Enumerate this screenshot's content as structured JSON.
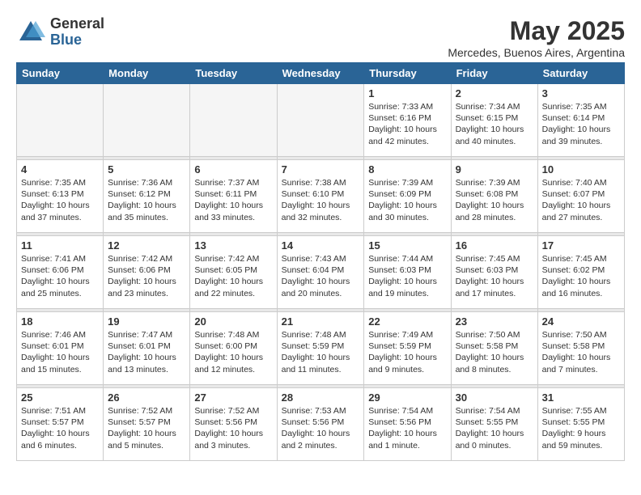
{
  "logo": {
    "general": "General",
    "blue": "Blue"
  },
  "header": {
    "title": "May 2025",
    "subtitle": "Mercedes, Buenos Aires, Argentina"
  },
  "days_of_week": [
    "Sunday",
    "Monday",
    "Tuesday",
    "Wednesday",
    "Thursday",
    "Friday",
    "Saturday"
  ],
  "weeks": [
    [
      {
        "day": "",
        "empty": true
      },
      {
        "day": "",
        "empty": true
      },
      {
        "day": "",
        "empty": true
      },
      {
        "day": "",
        "empty": true
      },
      {
        "day": "1",
        "sunrise": "Sunrise: 7:33 AM",
        "sunset": "Sunset: 6:16 PM",
        "daylight": "Daylight: 10 hours and 42 minutes."
      },
      {
        "day": "2",
        "sunrise": "Sunrise: 7:34 AM",
        "sunset": "Sunset: 6:15 PM",
        "daylight": "Daylight: 10 hours and 40 minutes."
      },
      {
        "day": "3",
        "sunrise": "Sunrise: 7:35 AM",
        "sunset": "Sunset: 6:14 PM",
        "daylight": "Daylight: 10 hours and 39 minutes."
      }
    ],
    [
      {
        "day": "4",
        "sunrise": "Sunrise: 7:35 AM",
        "sunset": "Sunset: 6:13 PM",
        "daylight": "Daylight: 10 hours and 37 minutes."
      },
      {
        "day": "5",
        "sunrise": "Sunrise: 7:36 AM",
        "sunset": "Sunset: 6:12 PM",
        "daylight": "Daylight: 10 hours and 35 minutes."
      },
      {
        "day": "6",
        "sunrise": "Sunrise: 7:37 AM",
        "sunset": "Sunset: 6:11 PM",
        "daylight": "Daylight: 10 hours and 33 minutes."
      },
      {
        "day": "7",
        "sunrise": "Sunrise: 7:38 AM",
        "sunset": "Sunset: 6:10 PM",
        "daylight": "Daylight: 10 hours and 32 minutes."
      },
      {
        "day": "8",
        "sunrise": "Sunrise: 7:39 AM",
        "sunset": "Sunset: 6:09 PM",
        "daylight": "Daylight: 10 hours and 30 minutes."
      },
      {
        "day": "9",
        "sunrise": "Sunrise: 7:39 AM",
        "sunset": "Sunset: 6:08 PM",
        "daylight": "Daylight: 10 hours and 28 minutes."
      },
      {
        "day": "10",
        "sunrise": "Sunrise: 7:40 AM",
        "sunset": "Sunset: 6:07 PM",
        "daylight": "Daylight: 10 hours and 27 minutes."
      }
    ],
    [
      {
        "day": "11",
        "sunrise": "Sunrise: 7:41 AM",
        "sunset": "Sunset: 6:06 PM",
        "daylight": "Daylight: 10 hours and 25 minutes."
      },
      {
        "day": "12",
        "sunrise": "Sunrise: 7:42 AM",
        "sunset": "Sunset: 6:06 PM",
        "daylight": "Daylight: 10 hours and 23 minutes."
      },
      {
        "day": "13",
        "sunrise": "Sunrise: 7:42 AM",
        "sunset": "Sunset: 6:05 PM",
        "daylight": "Daylight: 10 hours and 22 minutes."
      },
      {
        "day": "14",
        "sunrise": "Sunrise: 7:43 AM",
        "sunset": "Sunset: 6:04 PM",
        "daylight": "Daylight: 10 hours and 20 minutes."
      },
      {
        "day": "15",
        "sunrise": "Sunrise: 7:44 AM",
        "sunset": "Sunset: 6:03 PM",
        "daylight": "Daylight: 10 hours and 19 minutes."
      },
      {
        "day": "16",
        "sunrise": "Sunrise: 7:45 AM",
        "sunset": "Sunset: 6:03 PM",
        "daylight": "Daylight: 10 hours and 17 minutes."
      },
      {
        "day": "17",
        "sunrise": "Sunrise: 7:45 AM",
        "sunset": "Sunset: 6:02 PM",
        "daylight": "Daylight: 10 hours and 16 minutes."
      }
    ],
    [
      {
        "day": "18",
        "sunrise": "Sunrise: 7:46 AM",
        "sunset": "Sunset: 6:01 PM",
        "daylight": "Daylight: 10 hours and 15 minutes."
      },
      {
        "day": "19",
        "sunrise": "Sunrise: 7:47 AM",
        "sunset": "Sunset: 6:01 PM",
        "daylight": "Daylight: 10 hours and 13 minutes."
      },
      {
        "day": "20",
        "sunrise": "Sunrise: 7:48 AM",
        "sunset": "Sunset: 6:00 PM",
        "daylight": "Daylight: 10 hours and 12 minutes."
      },
      {
        "day": "21",
        "sunrise": "Sunrise: 7:48 AM",
        "sunset": "Sunset: 5:59 PM",
        "daylight": "Daylight: 10 hours and 11 minutes."
      },
      {
        "day": "22",
        "sunrise": "Sunrise: 7:49 AM",
        "sunset": "Sunset: 5:59 PM",
        "daylight": "Daylight: 10 hours and 9 minutes."
      },
      {
        "day": "23",
        "sunrise": "Sunrise: 7:50 AM",
        "sunset": "Sunset: 5:58 PM",
        "daylight": "Daylight: 10 hours and 8 minutes."
      },
      {
        "day": "24",
        "sunrise": "Sunrise: 7:50 AM",
        "sunset": "Sunset: 5:58 PM",
        "daylight": "Daylight: 10 hours and 7 minutes."
      }
    ],
    [
      {
        "day": "25",
        "sunrise": "Sunrise: 7:51 AM",
        "sunset": "Sunset: 5:57 PM",
        "daylight": "Daylight: 10 hours and 6 minutes."
      },
      {
        "day": "26",
        "sunrise": "Sunrise: 7:52 AM",
        "sunset": "Sunset: 5:57 PM",
        "daylight": "Daylight: 10 hours and 5 minutes."
      },
      {
        "day": "27",
        "sunrise": "Sunrise: 7:52 AM",
        "sunset": "Sunset: 5:56 PM",
        "daylight": "Daylight: 10 hours and 3 minutes."
      },
      {
        "day": "28",
        "sunrise": "Sunrise: 7:53 AM",
        "sunset": "Sunset: 5:56 PM",
        "daylight": "Daylight: 10 hours and 2 minutes."
      },
      {
        "day": "29",
        "sunrise": "Sunrise: 7:54 AM",
        "sunset": "Sunset: 5:56 PM",
        "daylight": "Daylight: 10 hours and 1 minute."
      },
      {
        "day": "30",
        "sunrise": "Sunrise: 7:54 AM",
        "sunset": "Sunset: 5:55 PM",
        "daylight": "Daylight: 10 hours and 0 minutes."
      },
      {
        "day": "31",
        "sunrise": "Sunrise: 7:55 AM",
        "sunset": "Sunset: 5:55 PM",
        "daylight": "Daylight: 9 hours and 59 minutes."
      }
    ]
  ]
}
